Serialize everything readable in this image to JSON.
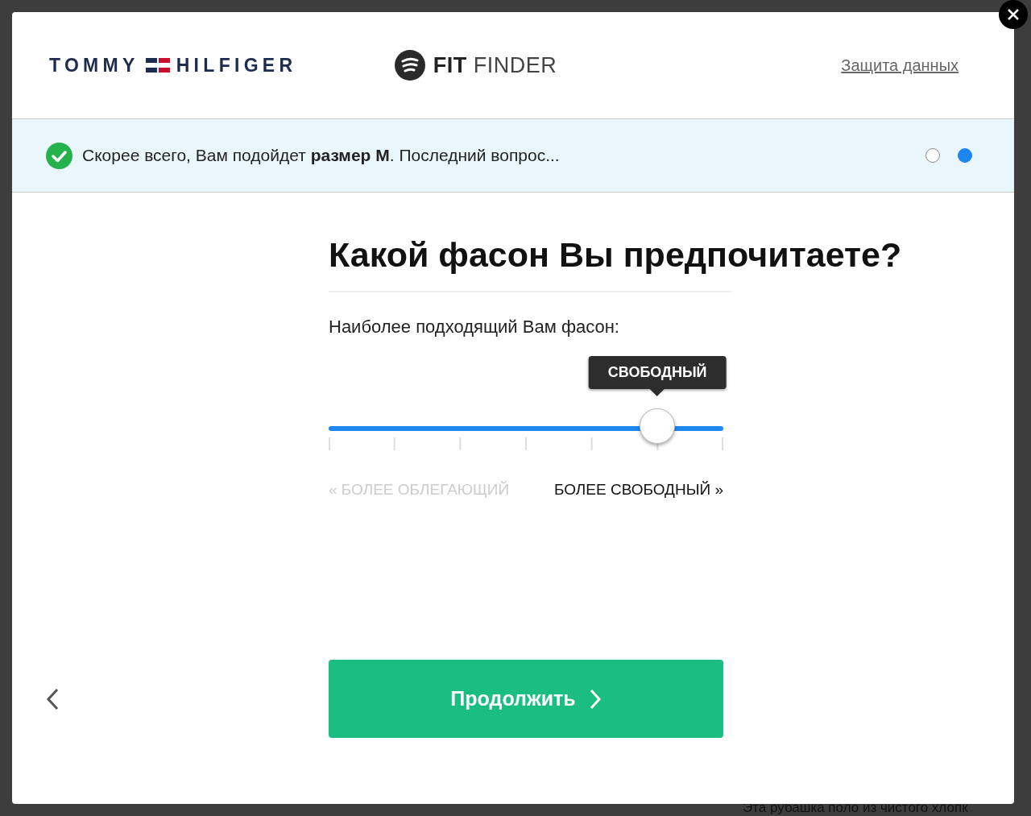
{
  "header": {
    "brand_logo": {
      "left": "TOMMY",
      "right": "HILFIGER"
    },
    "app_logo": {
      "bold": "FIT",
      "light": "FINDER"
    },
    "privacy_link": "Защита данных"
  },
  "banner": {
    "message": "Скорее всего, Вам подойдет **размер M**. Последний вопрос...",
    "steps": [
      {
        "selected": false
      },
      {
        "selected": true
      }
    ]
  },
  "question": {
    "title": "Какой фасон Вы предпочитаете?",
    "label": "Наиболее подходящий Вам фасон:",
    "slider": {
      "tooltip": "СВОБОДНЫЙ",
      "level": 0.833
    },
    "scale_labels": [
      {
        "text": "« БОЛЕЕ ОБЛЕГАЮЩИЙ",
        "disabled": true
      },
      {
        "text": "БОЛЕЕ СВОБОДНЫЙ »",
        "disabled": false
      }
    ]
  },
  "continue_button": "Продолжить",
  "background_text": "Эта рубашка поло из чистого хлопк"
}
